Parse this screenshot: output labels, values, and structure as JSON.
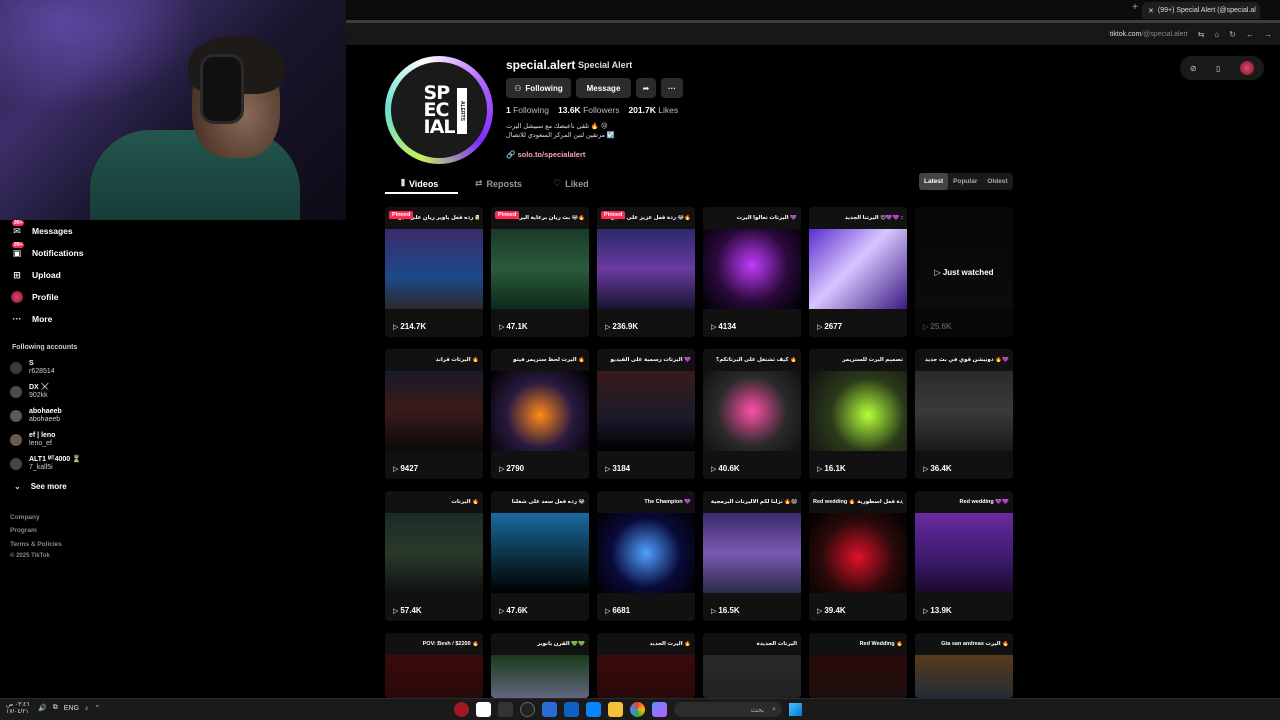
{
  "browser": {
    "tab_title": "(99+) Special Alert (@special.al",
    "url_host": "tiktok.com",
    "url_path": "/@special.alert"
  },
  "sidebar": {
    "items": [
      {
        "label": "Messages",
        "icon": "message-icon",
        "badge": "99+"
      },
      {
        "label": "Notifications",
        "icon": "inbox-icon",
        "badge": "99+"
      },
      {
        "label": "Upload",
        "icon": "upload-icon"
      },
      {
        "label": "Profile",
        "icon": "avatar-icon"
      },
      {
        "label": "More",
        "icon": "more-dots-icon"
      }
    ],
    "following_title": "Following accounts",
    "following": [
      {
        "name": "S",
        "handle": "r628514"
      },
      {
        "name": "DX ⚔️",
        "handle": "902kk"
      },
      {
        "name": "abohaeeb",
        "handle": "abohaeeb"
      },
      {
        "name": "ef | leno",
        "handle": "leno_ef"
      },
      {
        "name": "ALT1 ᴹᵀ4000 ⏳",
        "handle": "7_kall5i"
      }
    ],
    "see_more": "See more",
    "footer": [
      "Company",
      "Program",
      "Terms & Policies",
      "© 2025 TikTok"
    ]
  },
  "profile": {
    "username": "special.alert",
    "nickname": "Special Alert",
    "buttons": {
      "following": "Following",
      "message": "Message"
    },
    "stats": {
      "following": "1",
      "following_label": "Following",
      "followers": "13.6K",
      "followers_label": "Followers",
      "likes": "201.7K",
      "likes_label": "Likes"
    },
    "bio_line1": "تلقى ناعبضك مع سبيشل اليرت 🔥 😢",
    "bio_line2": "مرتقين لتين المركز السعودي للاتصال ☑️",
    "link": "solo.to/specialalert",
    "logo_text": "SP\nEC\nIAL",
    "logo_side": "ALERTS"
  },
  "tabs": {
    "videos": "Videos",
    "reposts": "Reposts",
    "liked": "Liked"
  },
  "sort": {
    "latest": "Latest",
    "popular": "Popular",
    "oldest": "Oldest"
  },
  "videos": [
    {
      "views": "214.7K",
      "pinned": "Pinned",
      "caption": "رده فعل ياوير ريان على اليرتات 🤯🔥",
      "theme": "a"
    },
    {
      "views": "47.1K",
      "pinned": "Pinned",
      "caption": "بث ريان برعاية اليرتاتنا 😂🔥",
      "theme": "b"
    },
    {
      "views": "236.9K",
      "pinned": "Pinned",
      "caption": "ردة فعل عزيز على الأليرتات 😂🔥",
      "theme": "c"
    },
    {
      "views": "4134",
      "caption": "اليرتات تعالوا اليرت 💜",
      "theme": "d"
    },
    {
      "views": "2677",
      "caption": "اليرتنا الجديد 😍💜💜 :",
      "theme": "e"
    },
    {
      "views": "25.6K",
      "overlay": "Just watched",
      "caption": "",
      "theme": "f"
    },
    {
      "views": "9427",
      "caption": "اليرتات قراند 🔥",
      "theme": "g"
    },
    {
      "views": "2790",
      "caption": "اليرت لحظ ستريمر فيتو 🔥",
      "theme": "h"
    },
    {
      "views": "3184",
      "caption": "اليرتات رسمية على الفيديو 💜",
      "theme": "i"
    },
    {
      "views": "40.6K",
      "caption": "كيف تشتغل على اليرتاتكم؟ 🔥",
      "theme": "j"
    },
    {
      "views": "16.1K",
      "caption": "تصميم اليرت للستريمر",
      "theme": "k"
    },
    {
      "views": "36.4K",
      "caption": "دونيشن قوي في بث جديد 🔥💜",
      "theme": "l"
    },
    {
      "views": "57.4K",
      "caption": "اليرتات 🔥",
      "theme": "m"
    },
    {
      "views": "47.6K",
      "caption": "رده فعل سعد على شغلنا 😂",
      "theme": "n"
    },
    {
      "views": "6681",
      "caption": "The Champion 💜",
      "theme": "o"
    },
    {
      "views": "16.5K",
      "caption": "نزلنا لكم الأليرتات البرمجية 🔥😱",
      "theme": "p"
    },
    {
      "views": "39.4K",
      "caption": "Red wedding 🔥 ردة فعل اسطورية",
      "theme": "q"
    },
    {
      "views": "13.9K",
      "caption": "Red wedding 💜💜",
      "theme": "r"
    },
    {
      "views": "",
      "caption": "POV: Besh / $2200 🔥",
      "theme": "s"
    },
    {
      "views": "",
      "caption": "القرن يانوير 💚💚",
      "theme": "t"
    },
    {
      "views": "",
      "caption": "اليرت الجديد 🔥",
      "theme": "u"
    },
    {
      "views": "",
      "caption": "اليرتات الجديدة",
      "theme": "v"
    },
    {
      "views": "",
      "caption": "Red Wedding 🔥",
      "theme": "w"
    },
    {
      "views": "",
      "caption": "Gta san andreas اليرت 🔥",
      "theme": "x"
    }
  ],
  "taskbar": {
    "time": "٠٣:٤٦ ص",
    "date": "١٧/٠٤/٢١",
    "lang": "ENG",
    "search_placeholder": "بحث"
  }
}
